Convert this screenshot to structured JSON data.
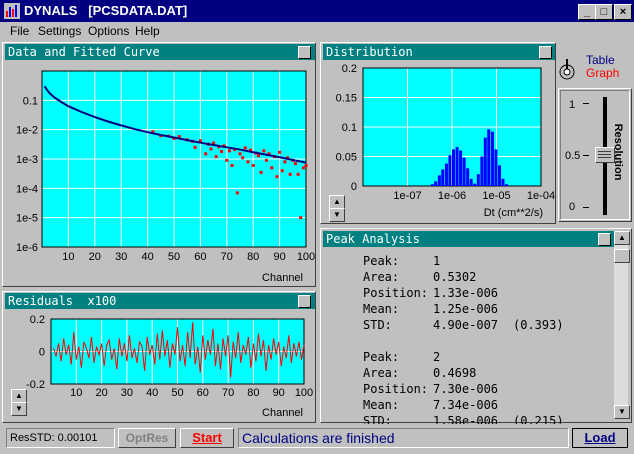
{
  "window": {
    "title": "DYNALS   [PCSDATA.DAT]"
  },
  "menu": [
    "File",
    "Settings",
    "Options",
    "Help"
  ],
  "panels": {
    "fit": {
      "title": "Data and Fitted Curve",
      "xlabel": "Channel"
    },
    "residuals": {
      "title": "Residuals  x100",
      "xlabel": "Channel"
    },
    "distribution": {
      "title": "Distribution",
      "xlabel": "Dt (cm**2/s)"
    },
    "peak": {
      "title": "Peak Analysis"
    }
  },
  "toggle": {
    "table": "Table",
    "graph": "Graph"
  },
  "resolution": {
    "label": "Resolution",
    "ticks": [
      "1",
      "0.5",
      "0"
    ],
    "value": 0.5
  },
  "peaks": [
    {
      "peak_label": "Peak:",
      "peak": "1",
      "area_label": "Area:",
      "area": "0.5302",
      "position_label": "Position:",
      "position": "1.33e-006",
      "mean_label": "Mean:",
      "mean": "1.25e-006",
      "std_label": "STD:",
      "std": "4.90e-007",
      "std_rel": "(0.393)"
    },
    {
      "peak_label": "Peak:",
      "peak": "2",
      "area_label": "Area:",
      "area": "0.4698",
      "position_label": "Position:",
      "position": "7.30e-006",
      "mean_label": "Mean:",
      "mean": "7.34e-006",
      "std_label": "STD:",
      "std": "1.58e-006",
      "std_rel": "(0.215)"
    }
  ],
  "statusbar": {
    "resstd": "ResSTD: 0.00101",
    "optres": "OptRes",
    "start": "Start",
    "message": "Calculations are finished",
    "load": "Load"
  },
  "colors": {
    "title": "#000080",
    "panel_title": "#008080",
    "plot_bg": "#00ffff",
    "data": "#ff0000",
    "fit": "#000080",
    "start_text": "#ff0000",
    "graph_text": "#ff0000"
  },
  "chart_data": [
    {
      "type": "scatter",
      "title": "Data and Fitted Curve",
      "xlabel": "Channel",
      "ylabel": "",
      "xlim": [
        0,
        100
      ],
      "ylim": [
        1e-06,
        1
      ],
      "yscale": "log",
      "xticks": [
        "10",
        "20",
        "30",
        "40",
        "50",
        "60",
        "70",
        "80",
        "90",
        "100"
      ],
      "yticks": [
        "0.1",
        "1e-2",
        "1e-3",
        "1e-4",
        "1e-5",
        "1e-6"
      ],
      "series": [
        {
          "kind": "fit-line",
          "x": [
            1,
            2,
            3,
            5,
            8,
            10,
            15,
            20,
            25,
            30,
            35,
            40,
            45,
            50,
            55,
            60,
            65,
            70,
            75,
            80,
            85,
            90,
            95,
            100
          ],
          "y": [
            0.3,
            0.22,
            0.17,
            0.12,
            0.08,
            0.063,
            0.04,
            0.027,
            0.019,
            0.014,
            0.0105,
            0.0082,
            0.0066,
            0.0054,
            0.0044,
            0.0036,
            0.003,
            0.0025,
            0.0021,
            0.0017,
            0.0014,
            0.00115,
            0.00093,
            0.00075
          ]
        },
        {
          "kind": "data-points",
          "x": [
            42,
            45,
            48,
            50,
            52,
            55,
            57,
            58,
            60,
            62,
            63,
            64,
            65,
            66,
            67,
            68,
            69,
            70,
            71,
            72,
            73,
            74,
            75,
            76,
            77,
            78,
            79,
            80,
            81,
            82,
            83,
            84,
            85,
            86,
            87,
            88,
            89,
            90,
            91,
            92,
            93,
            94,
            95,
            96,
            97,
            98,
            99,
            100
          ],
          "y": [
            0.0085,
            0.0062,
            0.006,
            0.005,
            0.0058,
            0.0045,
            0.004,
            0.0025,
            0.0042,
            0.0015,
            0.0032,
            0.0022,
            0.0035,
            0.0012,
            0.0026,
            0.0018,
            0.0028,
            0.0009,
            0.0019,
            0.0006,
            0.0021,
            7e-05,
            0.0015,
            0.0011,
            0.0024,
            0.0008,
            0.002,
            0.0006,
            0.0016,
            0.0013,
            0.00035,
            0.0019,
            0.0009,
            0.0015,
            0.0005,
            0.0012,
            0.00025,
            0.0017,
            0.0004,
            0.0008,
            0.0011,
            0.0003,
            0.0009,
            0.0007,
            0.0003,
            1e-05,
            0.0005,
            0.0006
          ]
        }
      ]
    },
    {
      "type": "line",
      "title": "Residuals  x100",
      "xlabel": "Channel",
      "ylabel": "",
      "xlim": [
        0,
        100
      ],
      "ylim": [
        -0.2,
        0.2
      ],
      "xticks": [
        "10",
        "20",
        "30",
        "40",
        "50",
        "60",
        "70",
        "80",
        "90",
        "100"
      ],
      "yticks": [
        "0.2",
        "0",
        "-0.2"
      ],
      "series": [
        {
          "name": "",
          "x": [
            1,
            2,
            3,
            4,
            5,
            6,
            7,
            8,
            9,
            10,
            11,
            12,
            13,
            14,
            15,
            16,
            17,
            18,
            19,
            20,
            21,
            22,
            23,
            24,
            25,
            26,
            27,
            28,
            29,
            30,
            31,
            32,
            33,
            34,
            35,
            36,
            37,
            38,
            39,
            40,
            41,
            42,
            43,
            44,
            45,
            46,
            47,
            48,
            49,
            50,
            51,
            52,
            53,
            54,
            55,
            56,
            57,
            58,
            59,
            60,
            61,
            62,
            63,
            64,
            65,
            66,
            67,
            68,
            69,
            70,
            71,
            72,
            73,
            74,
            75,
            76,
            77,
            78,
            79,
            80,
            81,
            82,
            83,
            84,
            85,
            86,
            87,
            88,
            89,
            90,
            91,
            92,
            93,
            94,
            95,
            96,
            97,
            98,
            99,
            100
          ],
          "y": [
            0.02,
            -0.03,
            0.05,
            -0.06,
            0.08,
            -0.02,
            0.04,
            -0.08,
            0.12,
            -0.05,
            0.03,
            -0.1,
            0.06,
            0.02,
            -0.04,
            0.09,
            -0.07,
            0.03,
            -0.02,
            0.05,
            -0.09,
            0.04,
            0.07,
            -0.05,
            0.02,
            -0.11,
            0.08,
            -0.03,
            0.05,
            -0.06,
            0.1,
            -0.04,
            0.02,
            -0.07,
            0.06,
            0.03,
            -0.12,
            0.09,
            -0.02,
            0.04,
            -0.08,
            0.11,
            -0.05,
            0.13,
            -0.03,
            0.07,
            -0.1,
            0.05,
            -0.02,
            0.15,
            -0.06,
            0.04,
            -0.09,
            0.12,
            -0.04,
            0.18,
            -0.08,
            0.03,
            -0.13,
            0.1,
            -0.05,
            0.07,
            -0.02,
            0.14,
            -0.09,
            0.05,
            -0.11,
            0.08,
            -0.03,
            0.1,
            -0.16,
            0.06,
            -0.04,
            0.12,
            -0.07,
            0.04,
            -0.02,
            0.09,
            -0.1,
            0.05,
            -0.06,
            0.11,
            -0.03,
            0.07,
            -0.12,
            0.04,
            -0.05,
            0.08,
            -0.02,
            0.06,
            -0.09,
            0.03,
            -0.04,
            0.1,
            -0.07,
            0.05,
            -0.03,
            0.06,
            -0.05,
            0.04
          ]
        }
      ]
    },
    {
      "type": "bar",
      "title": "Distribution",
      "xlabel": "Dt (cm**2/s)",
      "ylabel": "",
      "xscale": "log",
      "xlim": [
        1e-08,
        0.0001
      ],
      "ylim": [
        0,
        0.2
      ],
      "xticks": [
        "1e-07",
        "1e-06",
        "1e-05",
        "1e-04"
      ],
      "yticks": [
        "0.2",
        "0.15",
        "0.1",
        "0.05",
        "0"
      ],
      "series": [
        {
          "name": "",
          "x": [
            3e-07,
            3.6e-07,
            4.3e-07,
            5.2e-07,
            6.2e-07,
            7.5e-07,
            9e-07,
            1.08e-06,
            1.3e-06,
            1.56e-06,
            1.87e-06,
            2.25e-06,
            2.7e-06,
            3.24e-06,
            3.9e-06,
            4.7e-06,
            5.6e-06,
            6.7e-06,
            8.1e-06,
            9.7e-06,
            1.17e-05,
            1.4e-05,
            1.68e-05
          ],
          "y": [
            0.0,
            0.003,
            0.008,
            0.018,
            0.028,
            0.038,
            0.052,
            0.062,
            0.066,
            0.06,
            0.048,
            0.03,
            0.012,
            0.004,
            0.02,
            0.05,
            0.082,
            0.096,
            0.092,
            0.062,
            0.035,
            0.012,
            0.003
          ]
        }
      ]
    }
  ]
}
